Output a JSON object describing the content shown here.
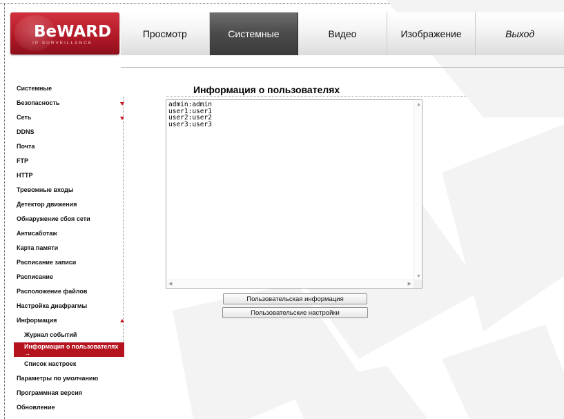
{
  "logo": {
    "text": "BeWARD",
    "subtitle": "IP SURVEILLANCE"
  },
  "topnav": {
    "tabs": [
      {
        "label": "Просмотр"
      },
      {
        "label": "Системные"
      },
      {
        "label": "Видео"
      },
      {
        "label": "Изображение"
      },
      {
        "label": "Выход"
      }
    ],
    "active": "Системные"
  },
  "sidebar": {
    "items": [
      {
        "label": "Системные"
      },
      {
        "label": "Безопасность",
        "expand": "down"
      },
      {
        "label": "Сеть",
        "expand": "down"
      },
      {
        "label": "DDNS"
      },
      {
        "label": "Почта"
      },
      {
        "label": "FTP"
      },
      {
        "label": "HTTP"
      },
      {
        "label": "Тревожные входы"
      },
      {
        "label": "Детектор движения"
      },
      {
        "label": "Обнаружение сбоя сети"
      },
      {
        "label": "Антисаботаж"
      },
      {
        "label": "Карта памяти"
      },
      {
        "label": "Расписание записи"
      },
      {
        "label": "Расписание"
      },
      {
        "label": "Расположение файлов"
      },
      {
        "label": "Настройка диафрагмы"
      },
      {
        "label": "Информация",
        "expand": "up"
      },
      {
        "label": "Журнал событий"
      },
      {
        "label": "Информация о пользователях",
        "arrow": "→"
      },
      {
        "label": "Список настроек"
      },
      {
        "label": "Параметры по умолчанию"
      },
      {
        "label": "Программная версия"
      },
      {
        "label": "Обновление"
      }
    ]
  },
  "main": {
    "title": "Информация о пользователях",
    "users_text": "admin:admin\nuser1:user1\nuser2:user2\nuser3:user3",
    "buttons": {
      "user_info": "Пользовательская информация",
      "user_settings": "Пользовательские настройки"
    }
  },
  "colors": {
    "brand_red": "#b5141f",
    "active_tab": "#4a4a4a",
    "marker_red": "#c8141f"
  },
  "icons": {
    "expand_down": "triangle-down-icon",
    "collapse_up": "triangle-up-icon",
    "active_arrow": "arrow-right-icon"
  }
}
